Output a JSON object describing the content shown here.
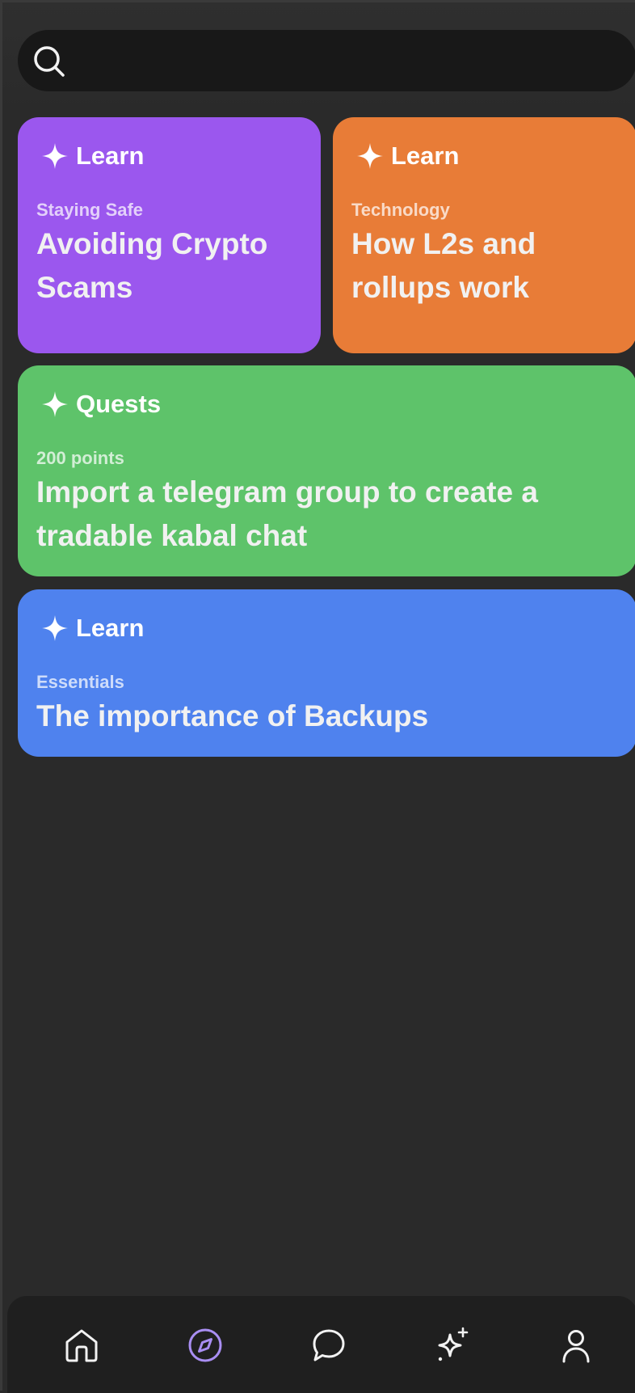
{
  "search": {
    "placeholder": ""
  },
  "cards": [
    {
      "kind": "Learn",
      "subtitle": "Staying Safe",
      "title": "Avoiding Crypto Scams",
      "color": "#9b57ee"
    },
    {
      "kind": "Learn",
      "subtitle": "Technology",
      "title": "How L2s and rollups work",
      "color": "#e87c37"
    },
    {
      "kind": "Quests",
      "subtitle": "200 points",
      "title": "Import a telegram group to create a tradable kabal chat",
      "color": "#5ec36a"
    },
    {
      "kind": "Learn",
      "subtitle": "Essentials",
      "title": "The importance of Backups",
      "color": "#4f82ee"
    }
  ],
  "nav": {
    "items": [
      {
        "icon": "home-icon",
        "active": false
      },
      {
        "icon": "compass-icon",
        "active": true
      },
      {
        "icon": "chat-bubble-icon",
        "active": false
      },
      {
        "icon": "sparkles-icon",
        "active": false
      },
      {
        "icon": "profile-icon",
        "active": false
      }
    ],
    "active_color": "#a98ef2",
    "inactive_color": "#f2f2f2"
  }
}
